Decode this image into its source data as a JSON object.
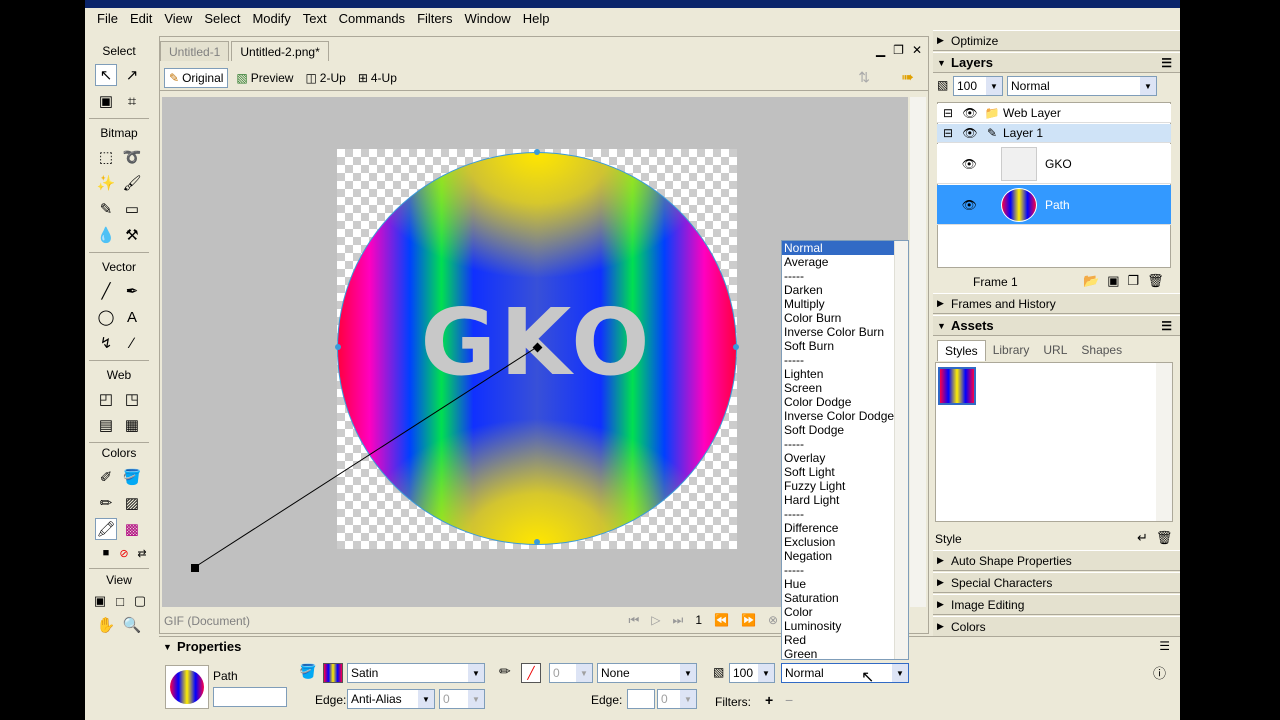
{
  "menu": [
    "File",
    "Edit",
    "View",
    "Select",
    "Modify",
    "Text",
    "Commands",
    "Filters",
    "Window",
    "Help"
  ],
  "tools": {
    "sections": [
      "Select",
      "Bitmap",
      "Vector",
      "Web",
      "Colors",
      "View"
    ]
  },
  "document": {
    "tabs": [
      "Untitled-1",
      "Untitled-2.png*"
    ],
    "view_modes": [
      "Original",
      "Preview",
      "2-Up",
      "4-Up"
    ],
    "canvas_text": "GKO",
    "status": "GIF (Document)",
    "frame_number": "1"
  },
  "blend_modes": {
    "selected": "Normal",
    "options": [
      "Normal",
      "Average",
      "-----",
      "Darken",
      "Multiply",
      "Color Burn",
      "Inverse Color Burn",
      "Soft Burn",
      "-----",
      "Lighten",
      "Screen",
      "Color Dodge",
      "Inverse Color Dodge",
      "Soft Dodge",
      "-----",
      "Overlay",
      "Soft Light",
      "Fuzzy Light",
      "Hard Light",
      "-----",
      "Difference",
      "Exclusion",
      "Negation",
      "-----",
      "Hue",
      "Saturation",
      "Color",
      "Luminosity",
      "Red",
      "Green"
    ]
  },
  "panels": {
    "optimize": "Optimize",
    "layers": {
      "title": "Layers",
      "opacity": "100",
      "blend": "Normal",
      "rows": [
        "Web Layer",
        "Layer 1",
        "GKO",
        "Path"
      ],
      "frame": "Frame 1"
    },
    "frames_history": "Frames and History",
    "assets": {
      "title": "Assets",
      "tabs": [
        "Styles",
        "Library",
        "URL",
        "Shapes"
      ],
      "style_label": "Style"
    },
    "collapsed": [
      "Auto Shape Properties",
      "Special Characters",
      "Image Editing",
      "Colors"
    ]
  },
  "properties": {
    "title": "Properties",
    "object_name": "Path",
    "fill_type": "Satin",
    "edge_label": "Edge:",
    "edge_value": "Anti-Alias",
    "edge_amount": "0",
    "stroke_amount": "0",
    "stroke_type": "None",
    "stroke_edge_label": "Edge:",
    "stroke_edge_amount": "0",
    "opacity": "100",
    "blend": "Normal",
    "filters_label": "Filters:"
  }
}
